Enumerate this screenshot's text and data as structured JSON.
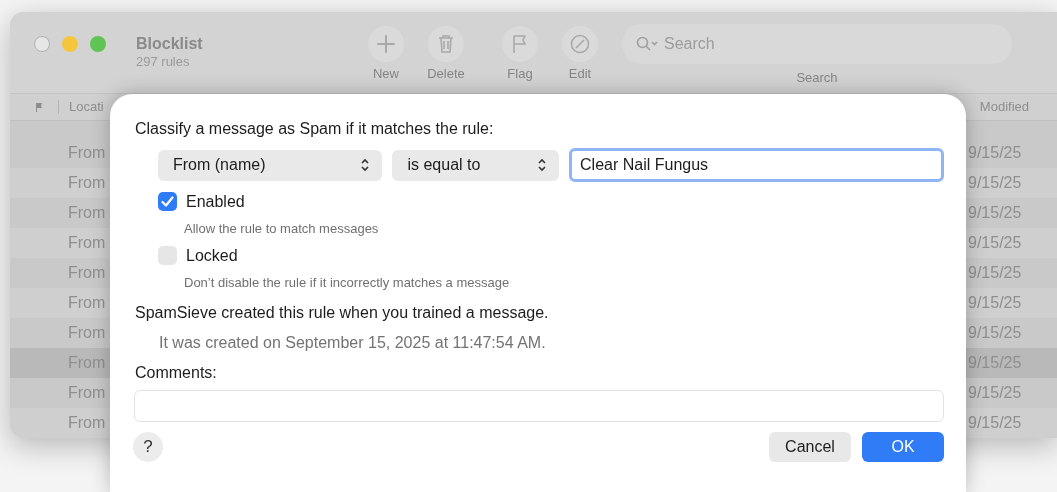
{
  "window": {
    "title": "Blocklist",
    "subtitle": "297 rules"
  },
  "toolbar": {
    "buttons": [
      {
        "label": "New",
        "kind": "plus"
      },
      {
        "label": "Delete",
        "kind": "trash"
      },
      {
        "label": "Flag",
        "kind": "flag"
      },
      {
        "label": "Edit",
        "kind": "edit"
      }
    ],
    "search": {
      "placeholder": "Search",
      "label": "Search"
    }
  },
  "table": {
    "columns": [
      "Locati",
      "Modified"
    ],
    "rows": [
      {
        "column_1": "From",
        "modified": "9/15/25",
        "selected": false
      },
      {
        "column_1": "From",
        "modified": "9/15/25",
        "selected": false
      },
      {
        "column_1": "From",
        "modified": "9/15/25",
        "selected": false
      },
      {
        "column_1": "From",
        "modified": "9/15/25",
        "selected": false
      },
      {
        "column_1": "From",
        "modified": "9/15/25",
        "selected": false
      },
      {
        "column_1": "From",
        "modified": "9/15/25",
        "selected": false
      },
      {
        "column_1": "From",
        "modified": "9/15/25",
        "selected": false
      },
      {
        "column_1": "From",
        "modified": "9/15/25",
        "selected": true
      },
      {
        "column_1": "From",
        "modified": "9/15/25",
        "selected": false
      },
      {
        "column_1": "From",
        "modified": "9/15/25",
        "selected": false
      }
    ]
  },
  "sheet": {
    "prompt": "Classify a message as Spam if it matches the rule:",
    "field_popup": "From (name)",
    "operator_popup": "is equal to",
    "value_field": "Clear Nail Fungus",
    "options": [
      {
        "label": "Enabled",
        "checked": true,
        "hint": "Allow the rule to match messages"
      },
      {
        "label": "Locked",
        "checked": false,
        "hint": "Don’t disable the rule if it incorrectly matches a message"
      }
    ],
    "info": "SpamSieve created this rule when you trained a message.",
    "created": "It was created on September 15, 2025 at 11:47:54 AM.",
    "comments_label": "Comments:",
    "help_button": "?",
    "buttons": [
      {
        "label": "Cancel",
        "kind": "secondary"
      },
      {
        "label": "OK",
        "kind": "default"
      }
    ]
  }
}
